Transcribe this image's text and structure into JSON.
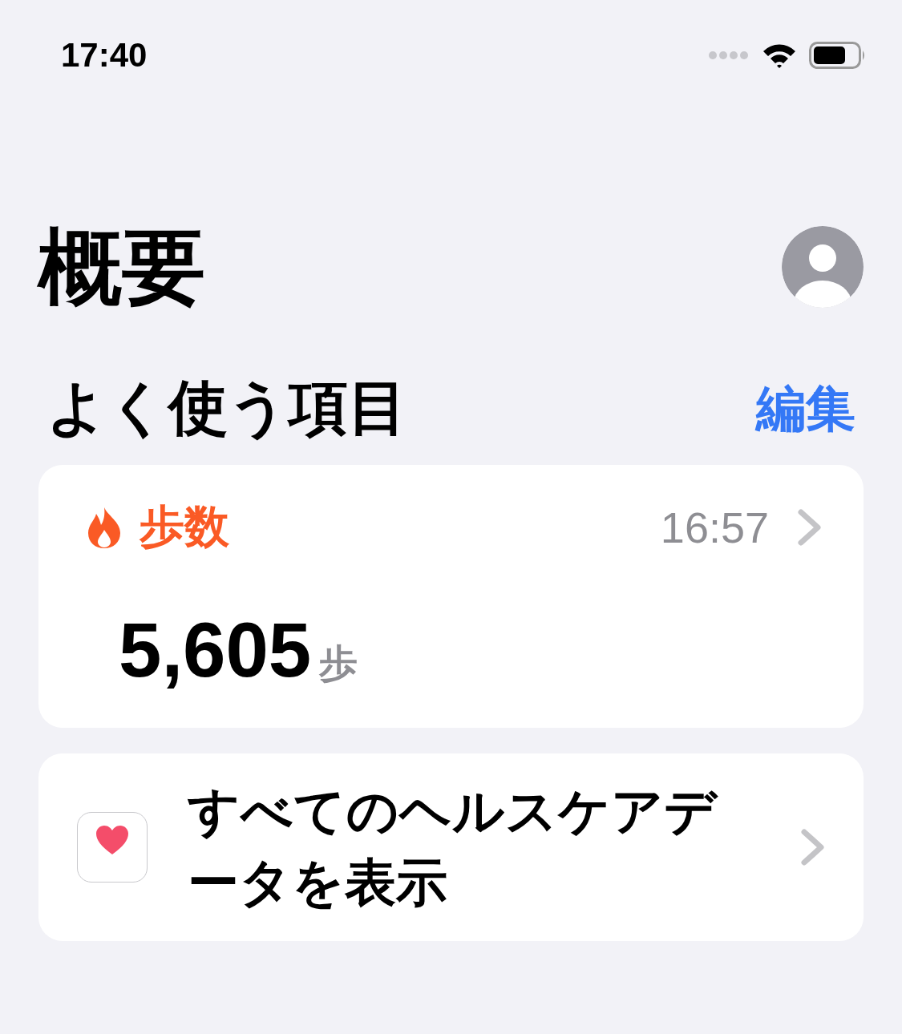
{
  "status_bar": {
    "time": "17:40"
  },
  "header": {
    "title": "概要"
  },
  "favorites": {
    "title": "よく使う項目",
    "edit": "編集"
  },
  "step_card": {
    "label": "歩数",
    "time": "16:57",
    "value": "5,605",
    "unit": "歩"
  },
  "all_data_card": {
    "label": "すべてのヘルスケアデータを表示"
  }
}
